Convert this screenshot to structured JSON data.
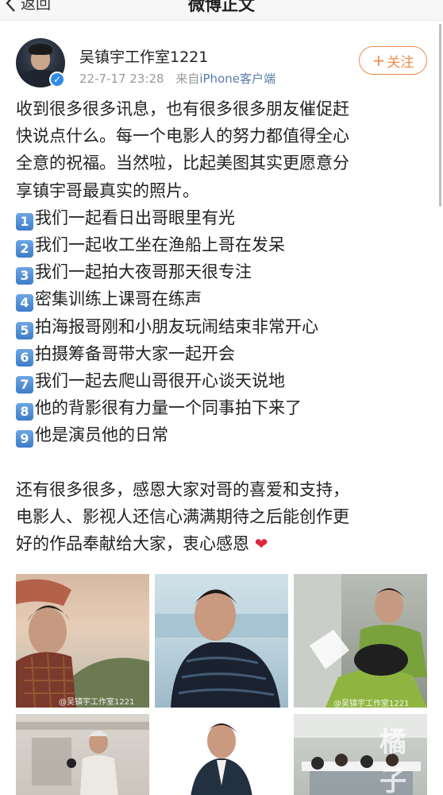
{
  "nav": {
    "back_label": "返回",
    "title": "微博正文"
  },
  "post": {
    "username": "吴镇宇工作室1221",
    "datetime": "22-7-17 23:28",
    "source_prefix": "来自",
    "source": "iPhone客户端",
    "follow_label": "关注",
    "verified_badge": "✓",
    "intro_lines": [
      "收到很多很多讯息，也有很多很多朋友催促赶",
      "快说点什么。每一个电影人的努力都值得全心",
      "全意的祝福。当然啦，比起美图其实更愿意分",
      "享镇宇哥最真实的照片。"
    ],
    "list_items": [
      {
        "num": "1",
        "text": "我们一起看日出哥眼里有光"
      },
      {
        "num": "2",
        "text": "我们一起收工坐在渔船上哥在发呆"
      },
      {
        "num": "3",
        "text": "我们一起拍大夜哥那天很专注"
      },
      {
        "num": "4",
        "text": "密集训练上课哥在练声"
      },
      {
        "num": "5",
        "text": "拍海报哥刚和小朋友玩闹结束非常开心"
      },
      {
        "num": "6",
        "text": "拍摄筹备哥带大家一起开会"
      },
      {
        "num": "7",
        "text": "我们一起去爬山哥很开心谈天说地"
      },
      {
        "num": "8",
        "text": "他的背影很有力量一个同事拍下来了"
      },
      {
        "num": "9",
        "text": "他是演员他的日常"
      }
    ],
    "closing_lines": [
      "还有很多很多，感恩大家对哥的喜爱和支持，",
      "电影人、影视人还信心满满期待之后能创作更",
      "好的作品奉献给大家，衷心感恩"
    ],
    "heart": "❤",
    "photo_watermarks": {
      "photo1": "@吴镇宇工作室1221",
      "photo3": "@吴镇宇工作室1221",
      "corner": "橘子"
    }
  },
  "colors": {
    "accent": "#f08a4b",
    "link": "#5b7ca8",
    "badge": "#2e8ce6",
    "number_box": "#3d7cc9",
    "heart": "#e0243a"
  }
}
